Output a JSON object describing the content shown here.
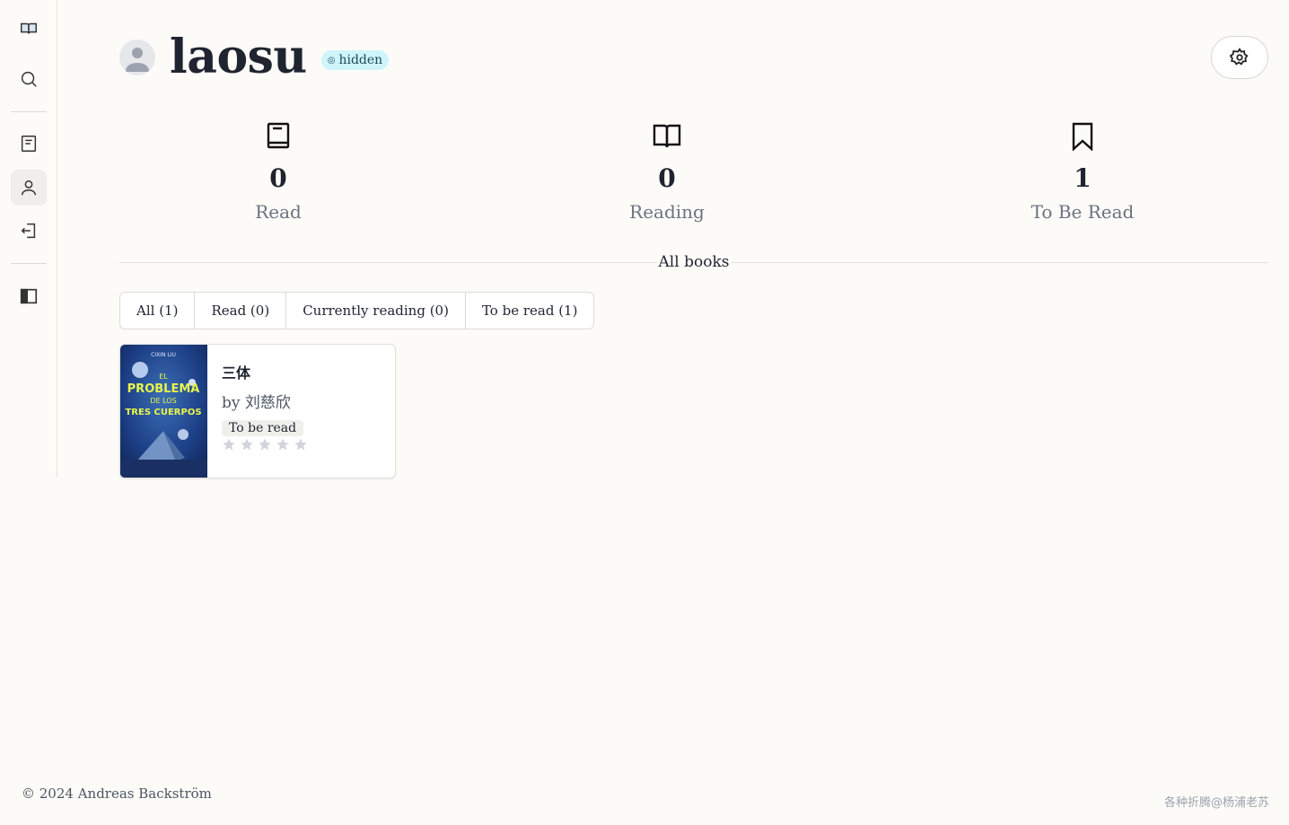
{
  "profile": {
    "username": "laosu",
    "visibility_badge": "hidden"
  },
  "stats": [
    {
      "icon": "book-icon",
      "count": "0",
      "label": "Read"
    },
    {
      "icon": "open-book-icon",
      "count": "0",
      "label": "Reading"
    },
    {
      "icon": "bookmark-icon",
      "count": "1",
      "label": "To Be Read"
    }
  ],
  "section_title": "All books",
  "tabs": [
    {
      "label": "All (1)"
    },
    {
      "label": "Read (0)"
    },
    {
      "label": "Currently reading (0)"
    },
    {
      "label": "To be read (1)"
    }
  ],
  "books": [
    {
      "title": "三体",
      "author": "by 刘慈欣",
      "status": "To be read",
      "rating": 0,
      "max_rating": 5,
      "cover_text": {
        "author": "CIXIN LIU",
        "line1": "EL",
        "line2": "PROBLEMA",
        "line3": "DE LOS",
        "line4": "TRES CUERPOS"
      }
    }
  ],
  "footer": "© 2024 Andreas Backström",
  "watermark": "各种折腾@杨浦老苏",
  "colors": {
    "background": "#fcfbf7",
    "badge_bg": "#cff5fb",
    "star_empty": "#d1d5db"
  }
}
